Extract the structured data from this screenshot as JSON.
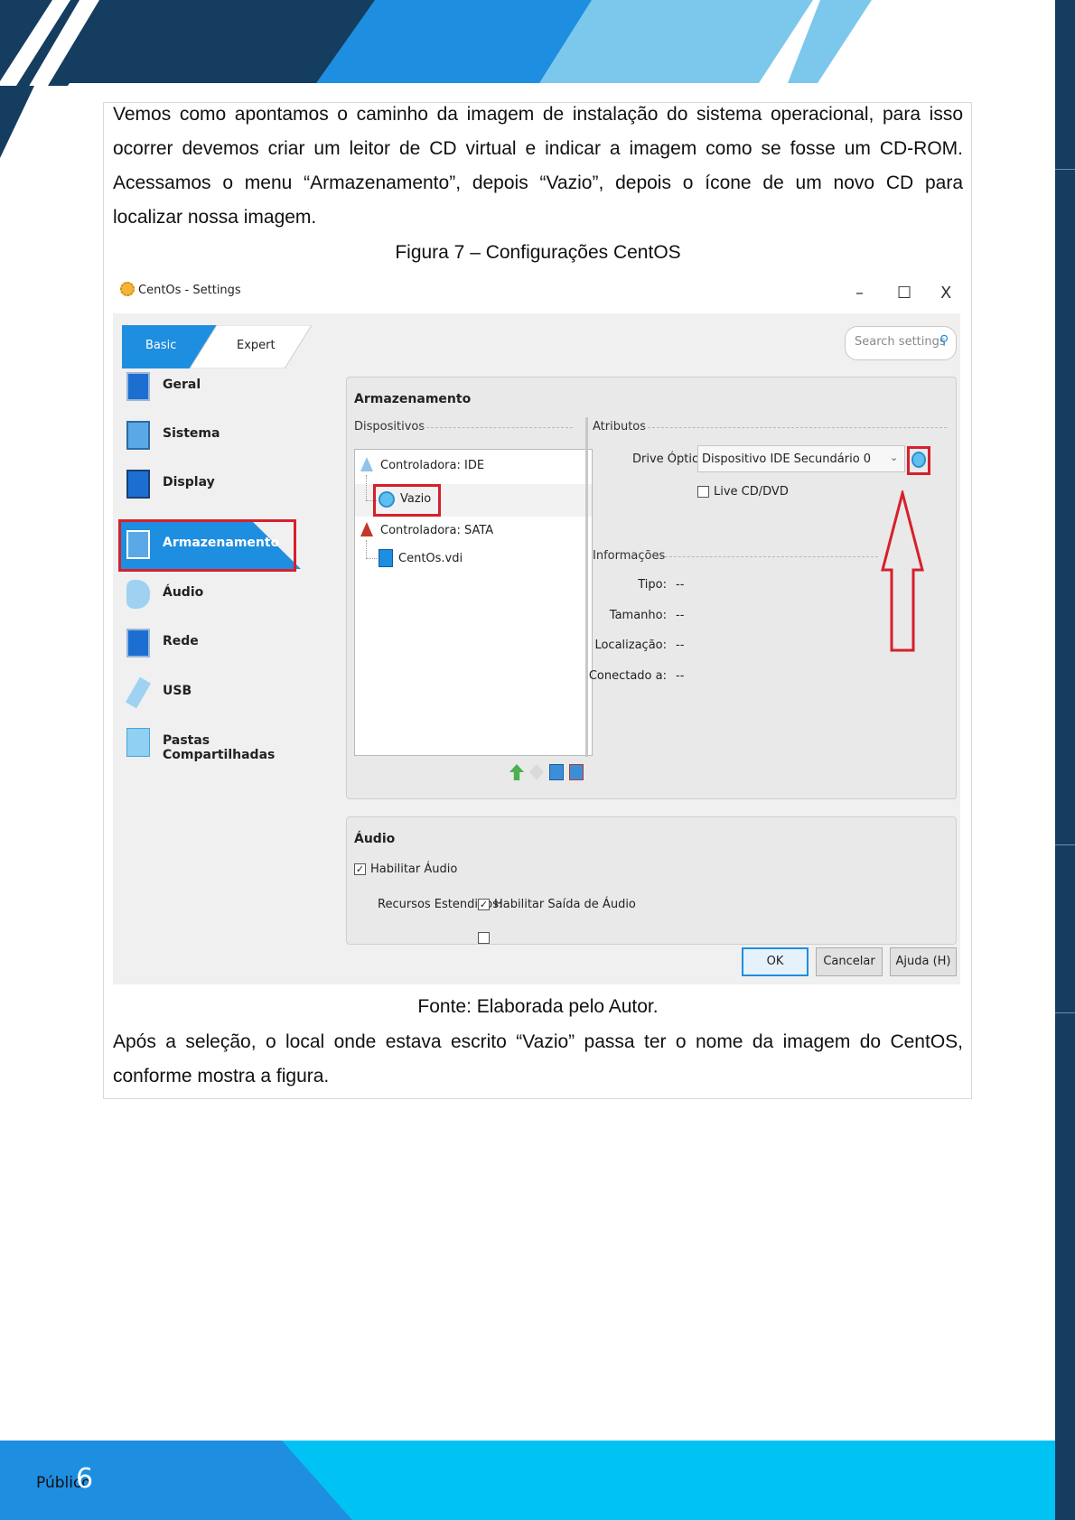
{
  "paragraph1_lines": [
    "Vemos como apontamos o caminho da imagem de instalação do sistema operacional, para isso",
    "ocorrer devemos criar um leitor de CD virtual e indicar a imagem como se fosse um CD-ROM.",
    "Acessamos o menu “Armazenamento”, depois “Vazio”, depois o ícone de um novo CD para",
    "localizar nossa imagem."
  ],
  "figure_caption": "Figura 7 – Configurações CentOS",
  "figure_source": "Fonte: Elaborada pelo Autor.",
  "paragraph2_lines": [
    "Após a seleção, o local onde estava escrito “Vazio” passa ter o nome da imagem do CentOS,",
    "conforme mostra a figura."
  ],
  "footer": {
    "label": "Público",
    "page_number": "6"
  },
  "colors": {
    "navy": "#143d60",
    "blue": "#1e8ee0",
    "light_blue": "#7cc8ec",
    "cyan": "#00c2f3",
    "highlight_red": "#d6202b"
  },
  "screenshot": {
    "window_title": "CentOs - Settings",
    "window_controls": [
      "–",
      "☐",
      "X"
    ],
    "mode_tabs": [
      "Basic",
      "Expert"
    ],
    "search_placeholder": "Search settings",
    "sidebar_items": [
      {
        "label": "Geral",
        "icon": "monitor-icon"
      },
      {
        "label": "Sistema",
        "icon": "chip-icon"
      },
      {
        "label": "Display",
        "icon": "display-icon"
      },
      {
        "label": "Armazenamento",
        "icon": "storage-icon"
      },
      {
        "label": "Áudio",
        "icon": "speaker-icon"
      },
      {
        "label": "Rede",
        "icon": "network-icon"
      },
      {
        "label": "USB",
        "icon": "usb-icon"
      },
      {
        "label": "Pastas Compartilhadas",
        "icon": "folder-icon"
      }
    ],
    "selected_sidebar_index": 3,
    "storage_section_title": "Armazenamento",
    "devices_label": "Dispositivos",
    "tree": [
      {
        "label": "Controladora: IDE",
        "level": 0
      },
      {
        "label": "Vazio",
        "level": 1
      },
      {
        "label": "Controladora: SATA",
        "level": 0
      },
      {
        "label": "CentOs.vdi",
        "level": 1
      }
    ],
    "attributes_label": "Atributos",
    "drive_label": "Drive Óptico:",
    "drive_value": "Dispositivo IDE Secundário 0",
    "live_cd_label": "Live CD/DVD",
    "info_label": "Informações",
    "info_rows": [
      {
        "key": "Tipo:",
        "value": "--"
      },
      {
        "key": "Tamanho:",
        "value": "--"
      },
      {
        "key": "Localização:",
        "value": "--"
      },
      {
        "key": "Conectado a:",
        "value": "--"
      }
    ],
    "audio_section_title": "Áudio",
    "enable_audio_label": "Habilitar Áudio",
    "extended_label": "Recursos Estendidos:",
    "enable_output_label": "Habilitar Saída de Áudio",
    "buttons": {
      "ok": "OK",
      "cancel": "Cancelar",
      "help": "Ajuda (H)"
    }
  }
}
